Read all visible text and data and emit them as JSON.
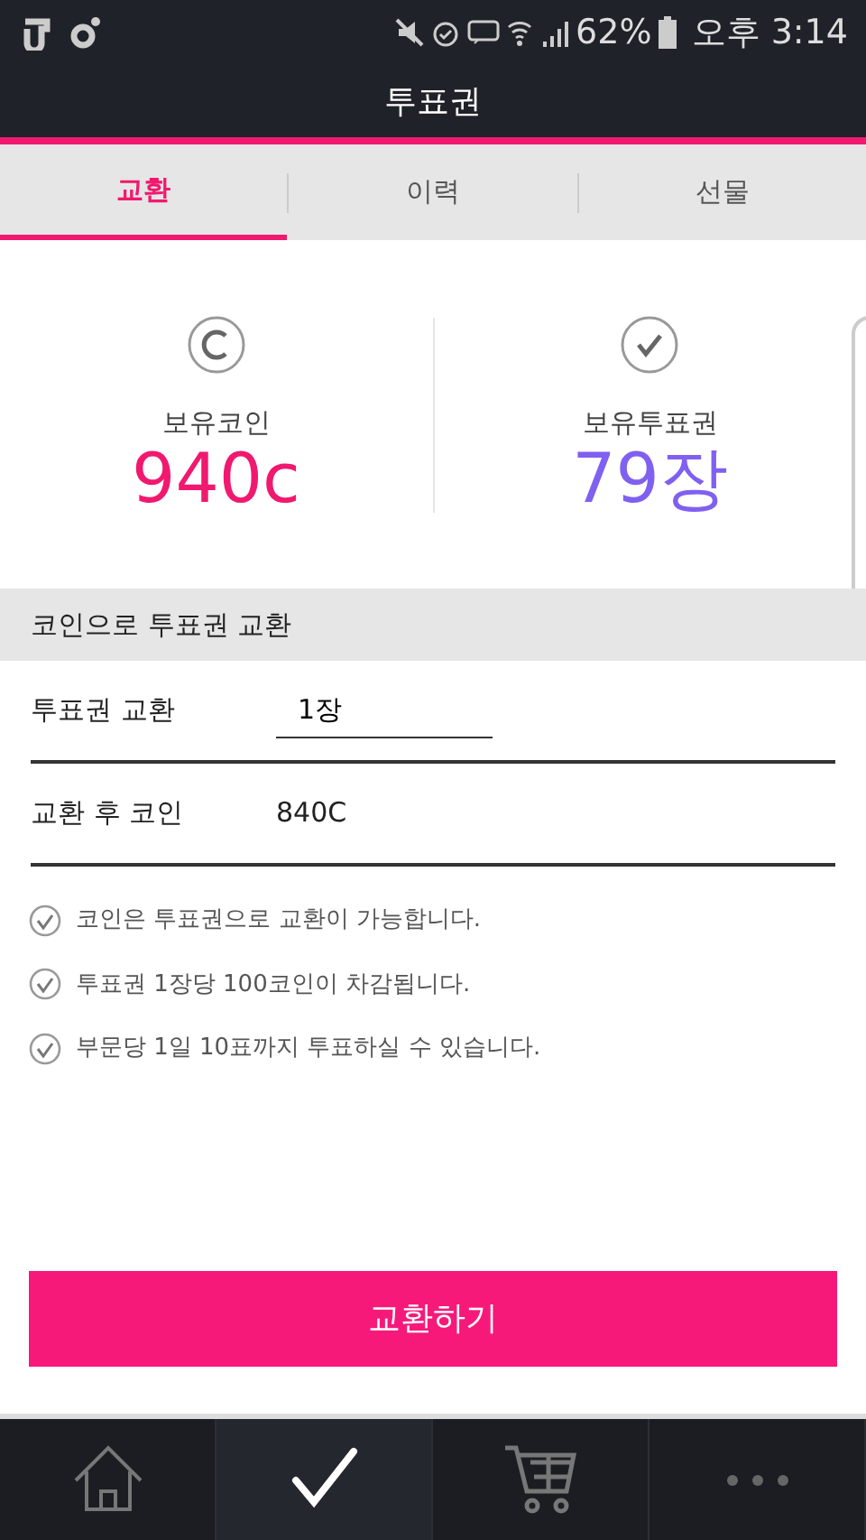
{
  "status_bar": {
    "battery": "62%",
    "time": "오후 3:14"
  },
  "title": "투표권",
  "tabs": [
    {
      "label": "교환",
      "selected": true
    },
    {
      "label": "이력",
      "selected": false
    },
    {
      "label": "선물",
      "selected": false
    }
  ],
  "stats": [
    {
      "kind": "coin",
      "label": "보유코인",
      "value": "940c",
      "color": "#f0196f"
    },
    {
      "kind": "ticket",
      "label": "보유투표권",
      "value": "79장",
      "color": "#8060f0"
    }
  ],
  "section_title": "코인으로 투표권 교환",
  "form_rows": [
    {
      "kind": "input",
      "label": "투표권 교환",
      "value": "1장"
    },
    {
      "kind": "text",
      "label": "교환 후 코인",
      "value": "840C"
    }
  ],
  "notes": [
    "코인은 투표권으로 교환이 가능합니다.",
    "투표권 1장당 100코인이 차감됩니다.",
    "부문당 1일 10표까지 투표하실 수 있습니다."
  ],
  "submit_button": "교환하기",
  "bottom_nav": [
    {
      "kind": "home",
      "selected": false
    },
    {
      "kind": "check",
      "selected": true
    },
    {
      "kind": "cart",
      "selected": false
    },
    {
      "kind": "more",
      "selected": false
    }
  ]
}
